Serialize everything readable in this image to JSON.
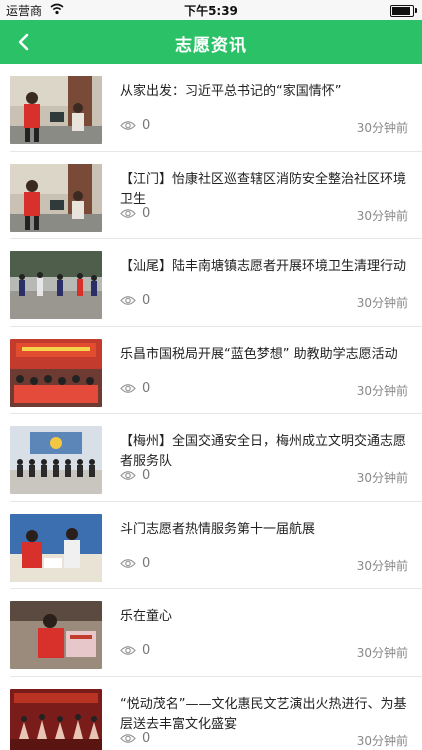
{
  "status_bar": {
    "carrier": "运营商",
    "time": "下午5:39"
  },
  "header": {
    "title": "志愿资讯",
    "back_icon": "chevron-left-icon"
  },
  "news_items": [
    {
      "title": "从家出发：习近平总书记的“家国情怀”",
      "views": "0",
      "time": "30分钟前"
    },
    {
      "title": "【江门】怡康社区巡查辖区消防安全整治社区环境卫生",
      "views": "0",
      "time": "30分钟前"
    },
    {
      "title": "【汕尾】陆丰南塘镇志愿者开展环境卫生清理行动",
      "views": "0",
      "time": "30分钟前"
    },
    {
      "title": "乐昌市国税局开展“蓝色梦想” 助教助学志愿活动",
      "views": "0",
      "time": "30分钟前"
    },
    {
      "title": "【梅州】全国交通安全日，梅州成立文明交通志愿者服务队",
      "views": "0",
      "time": "30分钟前"
    },
    {
      "title": "斗门志愿者热情服务第十一届航展",
      "views": "0",
      "time": "30分钟前"
    },
    {
      "title": "乐在童心",
      "views": "0",
      "time": "30分钟前"
    },
    {
      "title": "“悦动茂名”——文化惠民文艺演出火热进行、为基层送去丰富文化盛宴",
      "views": "0",
      "time": "30分钟前"
    }
  ],
  "colors": {
    "accent": "#2ac167"
  }
}
